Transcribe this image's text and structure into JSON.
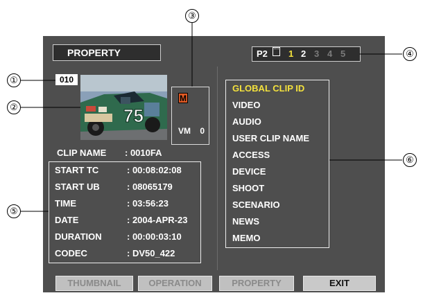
{
  "header": {
    "title": "PROPERTY"
  },
  "p2_status": {
    "label": "P2",
    "slots": [
      "1",
      "2",
      "3",
      "4",
      "5"
    ],
    "active_slots": [
      1,
      2
    ]
  },
  "clip": {
    "number": "010",
    "thumbnail_text": "75",
    "mark": "M",
    "vm_label": "VM",
    "vm_value": "0",
    "name_label": "CLIP NAME",
    "name_value": ": 0010FA"
  },
  "info_rows": [
    {
      "label": "START TC",
      "value": ": 00:08:02:08"
    },
    {
      "label": "START UB",
      "value": ": 08065179"
    },
    {
      "label": "TIME",
      "value": ": 03:56:23"
    },
    {
      "label": "DATE",
      "value": ": 2004-APR-23"
    },
    {
      "label": "DURATION",
      "value": ": 00:00:03:10"
    },
    {
      "label": "CODEC",
      "value": ": DV50_422"
    }
  ],
  "menu": {
    "items": [
      "GLOBAL CLIP ID",
      "VIDEO",
      "AUDIO",
      "USER CLIP NAME",
      "ACCESS",
      "DEVICE",
      "SHOOT",
      "SCENARIO",
      "NEWS",
      "MEMO"
    ],
    "selected": 0
  },
  "buttons": [
    {
      "label": "THUMBNAIL",
      "enabled": false
    },
    {
      "label": "OPERATION",
      "enabled": false
    },
    {
      "label": "PROPERTY",
      "enabled": false
    },
    {
      "label": "EXIT",
      "enabled": true
    }
  ],
  "callouts": [
    "①",
    "②",
    "③",
    "④",
    "⑤",
    "⑥"
  ],
  "colors": {
    "screen": "#4e4e4e",
    "selected": "#f4e23d",
    "mark": "#e25a24",
    "slot_active": "#f4e23d"
  }
}
